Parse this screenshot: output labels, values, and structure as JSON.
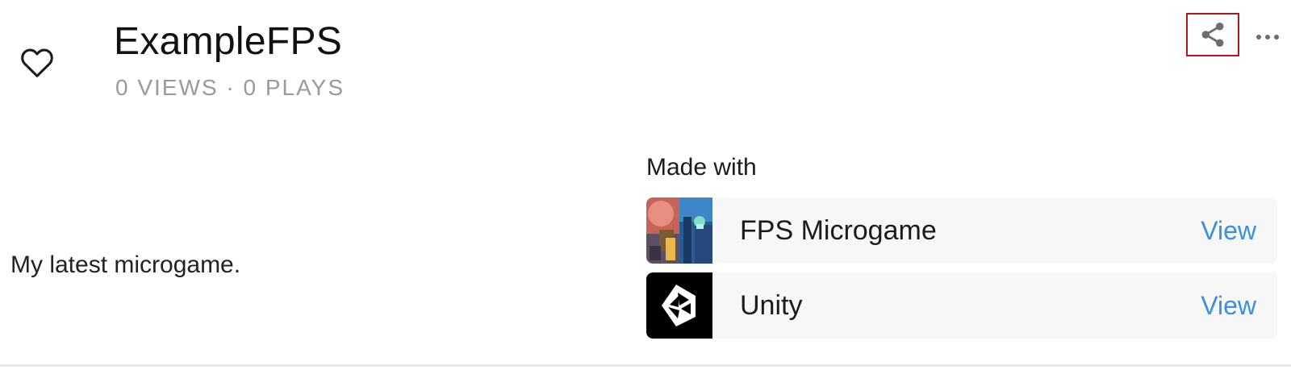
{
  "header": {
    "title": "ExampleFPS",
    "stats": "0 VIEWS · 0 PLAYS"
  },
  "icons": {
    "like": "heart-outline-icon",
    "share": "share-icon",
    "more": "more-horizontal-icon"
  },
  "description": "My latest microgame.",
  "made_with": {
    "label": "Made with",
    "items": [
      {
        "name": "FPS Microgame",
        "view_label": "View",
        "thumbnail": "fps-microgame-thumbnail"
      },
      {
        "name": "Unity",
        "view_label": "View",
        "thumbnail": "unity-logo"
      }
    ]
  },
  "colors": {
    "link": "#3d8fe0",
    "focus_outline": "#b3161b",
    "muted_text": "#9a9a9a",
    "card_background": "#f7f7f7"
  }
}
